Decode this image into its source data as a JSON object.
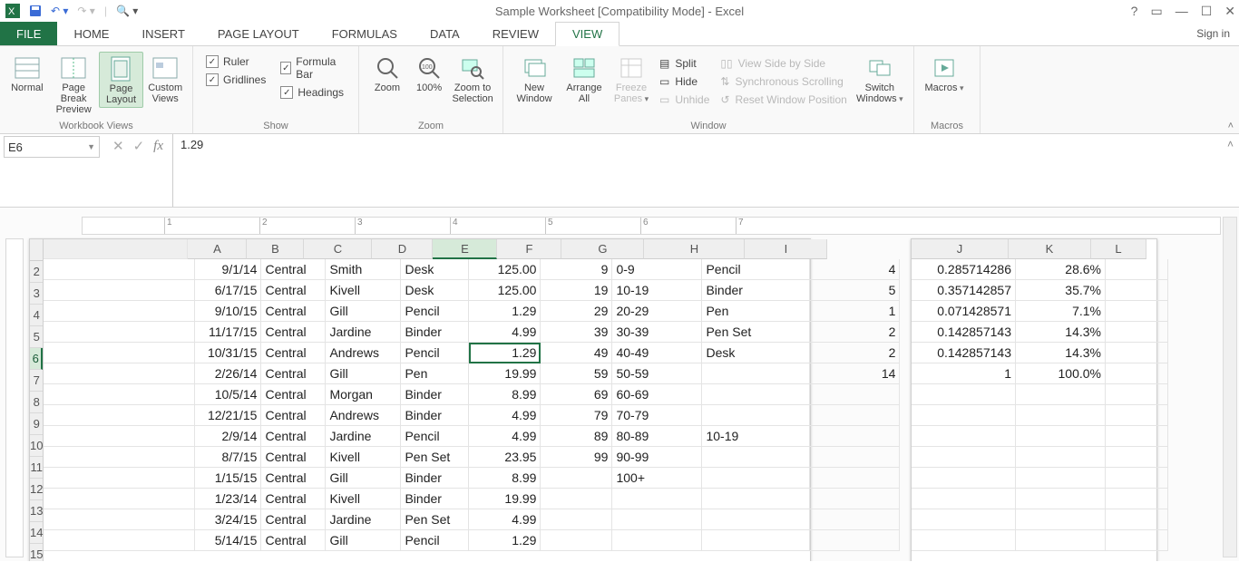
{
  "title": "Sample Worksheet  [Compatibility Mode] - Excel",
  "signin": "Sign in",
  "tabs": {
    "file": "FILE",
    "list": [
      "HOME",
      "INSERT",
      "PAGE LAYOUT",
      "FORMULAS",
      "DATA",
      "REVIEW",
      "VIEW"
    ],
    "active": "VIEW"
  },
  "ribbon": {
    "workbook_views": {
      "label": "Workbook Views",
      "normal": "Normal",
      "page_break": "Page Break\nPreview",
      "page_layout": "Page\nLayout",
      "custom_views": "Custom\nViews"
    },
    "show": {
      "label": "Show",
      "ruler": "Ruler",
      "gridlines": "Gridlines",
      "formula_bar": "Formula Bar",
      "headings": "Headings"
    },
    "zoom": {
      "label": "Zoom",
      "zoom": "Zoom",
      "p100": "100%",
      "zoom_sel": "Zoom to\nSelection"
    },
    "window": {
      "label": "Window",
      "new_window": "New\nWindow",
      "arrange_all": "Arrange\nAll",
      "freeze_panes": "Freeze\nPanes",
      "split": "Split",
      "hide": "Hide",
      "unhide": "Unhide",
      "view_sbs": "View Side by Side",
      "sync_scroll": "Synchronous Scrolling",
      "reset_pos": "Reset Window Position",
      "switch_windows": "Switch\nWindows"
    },
    "macros": {
      "label": "Macros",
      "macros": "Macros"
    }
  },
  "name_box": "E6",
  "formula_value": "1.29",
  "columns_left": [
    "A",
    "B",
    "C",
    "D",
    "E",
    "F",
    "G",
    "H",
    "I"
  ],
  "columns_right": [
    "J",
    "K",
    "L"
  ],
  "row_numbers": [
    2,
    3,
    4,
    5,
    6,
    7,
    8,
    9,
    10,
    11,
    12,
    13,
    14,
    15
  ],
  "selected": {
    "col": "E",
    "row": 6
  },
  "grid_left": [
    {
      "A": "9/1/14",
      "B": "Central",
      "C": "Smith",
      "D": "Desk",
      "E": "125.00",
      "F": "9",
      "G": "0-9",
      "H": "Pencil",
      "I": "4"
    },
    {
      "A": "6/17/15",
      "B": "Central",
      "C": "Kivell",
      "D": "Desk",
      "E": "125.00",
      "F": "19",
      "G": "10-19",
      "H": "Binder",
      "I": "5"
    },
    {
      "A": "9/10/15",
      "B": "Central",
      "C": "Gill",
      "D": "Pencil",
      "E": "1.29",
      "F": "29",
      "G": "20-29",
      "H": "Pen",
      "I": "1"
    },
    {
      "A": "11/17/15",
      "B": "Central",
      "C": "Jardine",
      "D": "Binder",
      "E": "4.99",
      "F": "39",
      "G": "30-39",
      "H": "Pen Set",
      "I": "2"
    },
    {
      "A": "10/31/15",
      "B": "Central",
      "C": "Andrews",
      "D": "Pencil",
      "E": "1.29",
      "F": "49",
      "G": "40-49",
      "H": "Desk",
      "I": "2"
    },
    {
      "A": "2/26/14",
      "B": "Central",
      "C": "Gill",
      "D": "Pen",
      "E": "19.99",
      "F": "59",
      "G": "50-59",
      "H": "",
      "I": "14"
    },
    {
      "A": "10/5/14",
      "B": "Central",
      "C": "Morgan",
      "D": "Binder",
      "E": "8.99",
      "F": "69",
      "G": "60-69",
      "H": "",
      "I": ""
    },
    {
      "A": "12/21/15",
      "B": "Central",
      "C": "Andrews",
      "D": "Binder",
      "E": "4.99",
      "F": "79",
      "G": "70-79",
      "H": "",
      "I": ""
    },
    {
      "A": "2/9/14",
      "B": "Central",
      "C": "Jardine",
      "D": "Pencil",
      "E": "4.99",
      "F": "89",
      "G": "80-89",
      "H": "10-19",
      "I": ""
    },
    {
      "A": "8/7/15",
      "B": "Central",
      "C": "Kivell",
      "D": "Pen Set",
      "E": "23.95",
      "F": "99",
      "G": "90-99",
      "H": "",
      "I": ""
    },
    {
      "A": "1/15/15",
      "B": "Central",
      "C": "Gill",
      "D": "Binder",
      "E": "8.99",
      "F": "",
      "G": "100+",
      "H": "",
      "I": ""
    },
    {
      "A": "1/23/14",
      "B": "Central",
      "C": "Kivell",
      "D": "Binder",
      "E": "19.99",
      "F": "",
      "G": "",
      "H": "",
      "I": ""
    },
    {
      "A": "3/24/15",
      "B": "Central",
      "C": "Jardine",
      "D": "Pen Set",
      "E": "4.99",
      "F": "",
      "G": "",
      "H": "",
      "I": ""
    },
    {
      "A": "5/14/15",
      "B": "Central",
      "C": "Gill",
      "D": "Pencil",
      "E": "1.29",
      "F": "",
      "G": "",
      "H": "",
      "I": ""
    }
  ],
  "grid_right": [
    {
      "J": "0.285714286",
      "K": "28.6%"
    },
    {
      "J": "0.357142857",
      "K": "35.7%"
    },
    {
      "J": "0.071428571",
      "K": "7.1%"
    },
    {
      "J": "0.142857143",
      "K": "14.3%"
    },
    {
      "J": "0.142857143",
      "K": "14.3%"
    },
    {
      "J": "1",
      "K": "100.0%"
    },
    {
      "J": "",
      "K": ""
    },
    {
      "J": "",
      "K": ""
    },
    {
      "J": "",
      "K": ""
    },
    {
      "J": "",
      "K": ""
    },
    {
      "J": "",
      "K": ""
    },
    {
      "J": "",
      "K": ""
    },
    {
      "J": "",
      "K": ""
    },
    {
      "J": "",
      "K": ""
    }
  ],
  "ruler_ticks": [
    "1",
    "2",
    "3",
    "4",
    "5",
    "6",
    "7"
  ]
}
